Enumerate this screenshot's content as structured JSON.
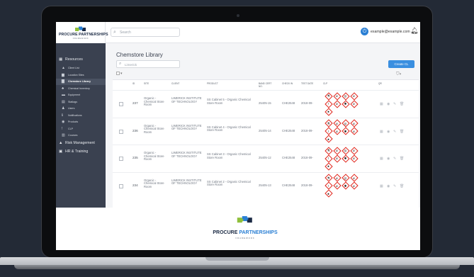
{
  "app": {
    "brand_name": "PROCURE PARTNERSHIPS",
    "brand_sub": "FRAMEWORK"
  },
  "topbar": {
    "search_placeholder": "Search",
    "user_email": "example@example.com ⌄",
    "icons": [
      "search-icon",
      "power-icon",
      "bell-icon"
    ]
  },
  "sidebar": {
    "groups": [
      {
        "label": "Resources",
        "icon": "grid-icon"
      },
      {
        "label": "Risk Management",
        "icon": "warning-icon"
      },
      {
        "label": "HR & Training",
        "icon": "id-card-icon"
      }
    ],
    "items": [
      {
        "label": "Client List",
        "icon": "user-icon"
      },
      {
        "label": "Location Sites",
        "icon": "building-icon"
      },
      {
        "label": "Chemstore Library",
        "icon": "book-icon",
        "active": true
      },
      {
        "label": "Chemical Inventory",
        "icon": "flask-icon"
      },
      {
        "label": "Equipment",
        "icon": "equipment-icon"
      },
      {
        "label": "Statlags",
        "icon": "document-icon"
      },
      {
        "label": "Users",
        "icon": "users-icon"
      },
      {
        "label": "Notifications",
        "icon": "info-icon"
      },
      {
        "label": "Products",
        "icon": "product-icon"
      },
      {
        "label": "CLP",
        "icon": "exclamation-icon"
      },
      {
        "label": "Courses",
        "icon": "course-icon"
      }
    ]
  },
  "main": {
    "title": "Chemstore Library",
    "filter_value": "Limerick",
    "create_button": "Create CL",
    "bulk_icon": "checkbox-dropdown-icon",
    "clp_toggle_icon": "filter-icon"
  },
  "table": {
    "headers": [
      "ID",
      "SITE",
      "CLIENT",
      "PRODUCT",
      "BAND CERT NO.",
      "CHECK IN",
      "TEST DATE",
      "CLP",
      "QR"
    ],
    "rows": [
      {
        "id": "237",
        "site": "Organic - Chemical Store Room",
        "client": "LIMERICK INSTITUTE OF TECHNOLOGY",
        "product": "SS Cabinet 5 - Organic Chemical Store Room",
        "cert": "25405-15",
        "check": "CHE2548",
        "date": "2018-09-"
      },
      {
        "id": "236",
        "site": "Organic - Chemical Store Room",
        "client": "LIMERICK INSTITUTE OF TECHNOLOGY",
        "product": "SS Cabinet 4 - Organic Chemical Store Room",
        "cert": "25405-14",
        "check": "CHE2548",
        "date": "2018-09-"
      },
      {
        "id": "235",
        "site": "Organic - Chemical Store Room",
        "client": "LIMERICK INSTITUTE OF TECHNOLOGY",
        "product": "SS Cabinet 3 - Organic Chemical Store Room",
        "cert": "25405-12",
        "check": "CHE2548",
        "date": "2018-09-"
      },
      {
        "id": "234",
        "site": "Organic - Chemical Store Room",
        "client": "LIMERICK INSTITUTE OF TECHNOLOGY",
        "product": "SS Cabinet 2 - Organic Chemical Store Room",
        "cert": "25405-13",
        "check": "CHE2548",
        "date": "2018-09-"
      }
    ],
    "clp_icons": [
      "corrosive-icon",
      "flammable-icon",
      "oxidiser-icon",
      "flammable-icon",
      "exclamation-icon",
      "flammable-icon",
      "health-hazard-icon",
      "flammable-icon",
      "environment-icon"
    ],
    "row_actions": [
      "qr-icon",
      "view-icon",
      "edit-icon",
      "delete-icon"
    ]
  },
  "footer": {
    "brand_left": "PROCURE ",
    "brand_right": "PARTNERSHIPS",
    "brand_sub": "FRAMEWORK"
  },
  "colors": {
    "accent": "#3a8fe0",
    "sidebar": "#3a4150",
    "hazard_red": "#e0251b"
  }
}
